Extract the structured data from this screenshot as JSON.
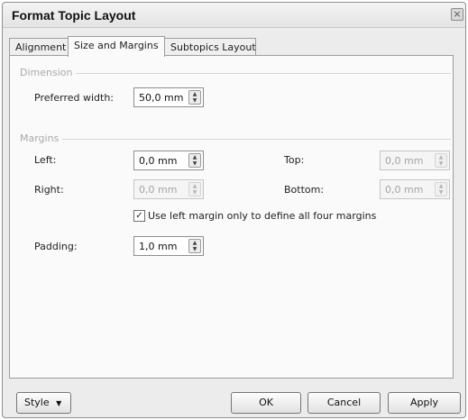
{
  "window": {
    "title": "Format Topic Layout",
    "close_glyph": "×"
  },
  "tabs": [
    {
      "label": "Alignment"
    },
    {
      "label": "Size and Margins"
    },
    {
      "label": "Subtopics Layout"
    }
  ],
  "dimension": {
    "header": "Dimension",
    "preferred_width": {
      "label": "Preferred width:",
      "value": "50,0 mm"
    }
  },
  "margins": {
    "header": "Margins",
    "left": {
      "label": "Left:",
      "value": "0,0 mm"
    },
    "right": {
      "label": "Right:",
      "value": "0,0 mm"
    },
    "top": {
      "label": "Top:",
      "value": "0,0 mm"
    },
    "bottom": {
      "label": "Bottom:",
      "value": "0,0 mm"
    },
    "checkbox": {
      "label": "Use left margin only to define all four margins",
      "checked": true,
      "mark": "✓"
    }
  },
  "padding": {
    "label": "Padding:",
    "value": "1,0 mm"
  },
  "footer": {
    "style_label": "Style",
    "style_arrow": "▼",
    "ok_label": "OK",
    "cancel_label": "Cancel",
    "apply_label": "Apply"
  },
  "icons": {
    "spin_up": "▲",
    "spin_down": "▼"
  }
}
